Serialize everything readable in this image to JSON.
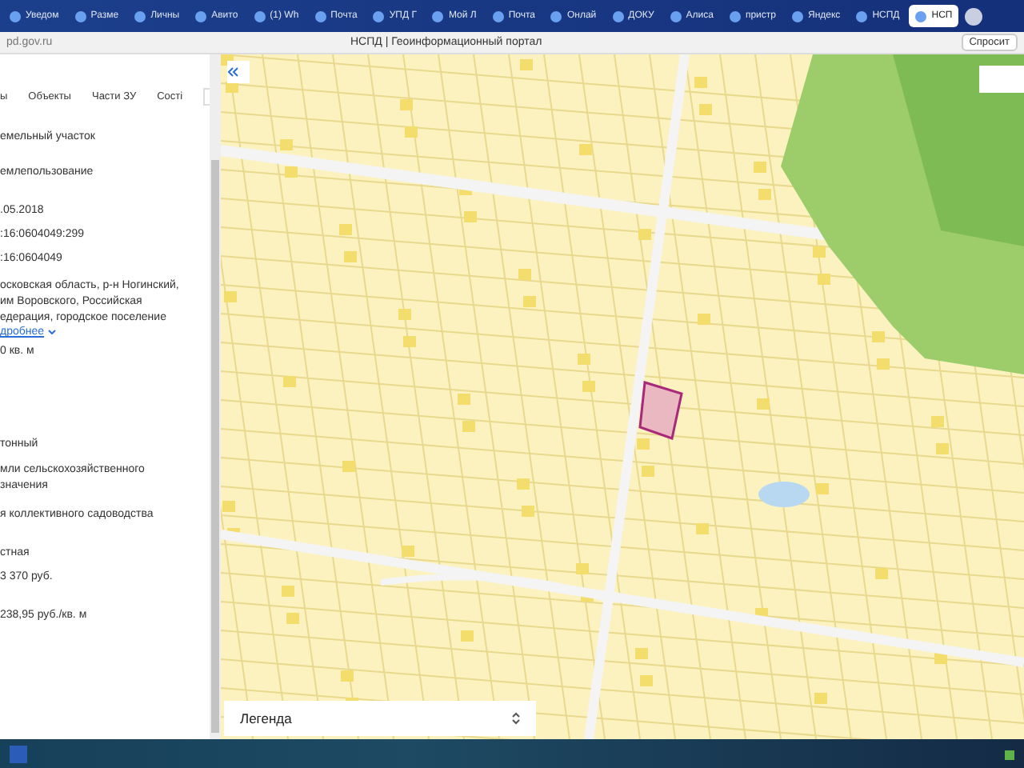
{
  "browser": {
    "tabs": [
      {
        "label": "Уведом",
        "selected": false
      },
      {
        "label": "Разме",
        "selected": false
      },
      {
        "label": "Личны",
        "selected": false
      },
      {
        "label": "Авито",
        "selected": false
      },
      {
        "label": "(1) Wh",
        "selected": false
      },
      {
        "label": "Почта",
        "selected": false
      },
      {
        "label": "УПД Г",
        "selected": false
      },
      {
        "label": "Мой Л",
        "selected": false
      },
      {
        "label": "Почта",
        "selected": false
      },
      {
        "label": "Онлай",
        "selected": false
      },
      {
        "label": "ДОКУ",
        "selected": false
      },
      {
        "label": "Алиса",
        "selected": false
      },
      {
        "label": "пристр",
        "selected": false
      },
      {
        "label": "Яндекс",
        "selected": false
      },
      {
        "label": "НСПД",
        "selected": false
      },
      {
        "label": "НСП",
        "selected": true
      }
    ],
    "address": "pd.gov.ru",
    "page_title": "НСПД | Геоинформационный портал",
    "ask_button": "Спросит"
  },
  "sidebar": {
    "tabs": [
      "ы",
      "Объекты",
      "Части ЗУ",
      "Сості"
    ],
    "fields": [
      {
        "lines": [
          "емельный участок"
        ]
      },
      {
        "lines": [
          "емлепользование"
        ]
      },
      {
        "lines": [
          ".05.2018"
        ]
      },
      {
        "lines": [
          ":16:0604049:299"
        ]
      },
      {
        "lines": [
          ":16:0604049"
        ]
      },
      {
        "lines": [
          "осковская область, р-н Ногинский,",
          "им Воровского, Российская",
          "едерация, городское поселение"
        ],
        "link": "дробнее"
      },
      {
        "lines": [
          "0 кв. м"
        ]
      },
      {
        "lines": [
          "тонный"
        ]
      },
      {
        "lines": [
          "мли сельскохозяйственного",
          "значения"
        ]
      },
      {
        "lines": [
          "я коллективного садоводства"
        ]
      },
      {
        "lines": [
          "стная"
        ]
      },
      {
        "lines": [
          "3 370 руб."
        ]
      },
      {
        "lines": [
          "238,95 руб./кв. м"
        ]
      }
    ]
  },
  "map": {
    "legend": "Легенда"
  }
}
